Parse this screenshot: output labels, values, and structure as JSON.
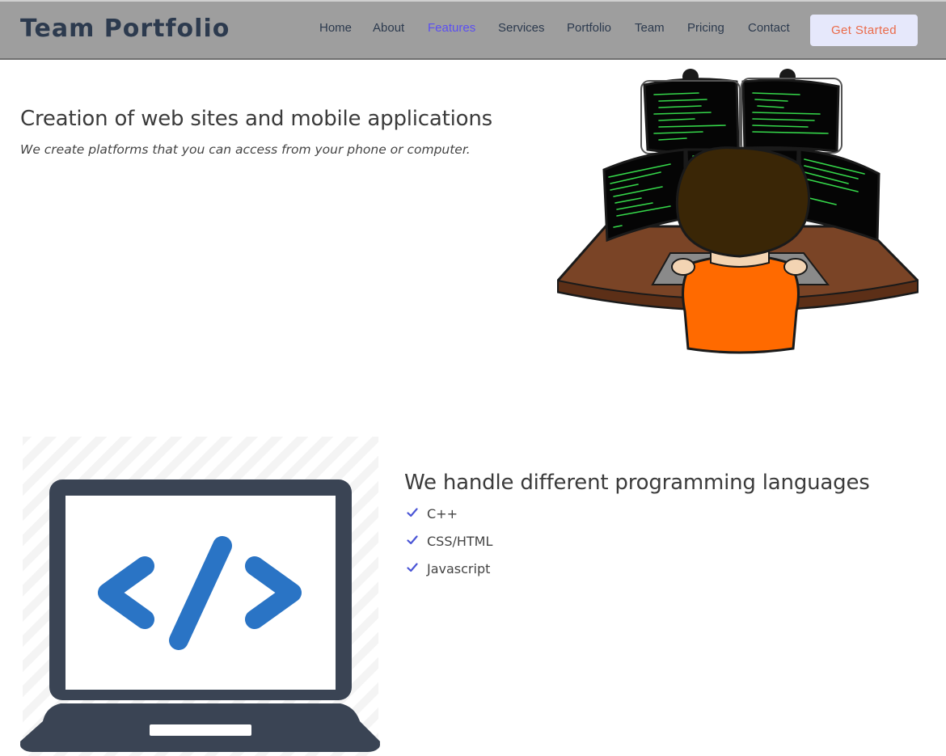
{
  "header": {
    "logo": "Team Portfolio",
    "nav": [
      {
        "label": "Home",
        "active": false
      },
      {
        "label": "About",
        "active": false
      },
      {
        "label": "Features",
        "active": true
      },
      {
        "label": "Services",
        "active": false
      },
      {
        "label": "Portfolio",
        "active": false
      },
      {
        "label": "Team",
        "active": false
      },
      {
        "label": "Pricing",
        "active": false
      },
      {
        "label": "Contact",
        "active": false
      }
    ],
    "cta_label": "Get Started"
  },
  "section1": {
    "title": "Creation of web sites and mobile applications",
    "subtitle": "We create platforms that you can access from your phone or computer.",
    "illustration": "programmer-at-multiple-monitors"
  },
  "section2": {
    "title": "We handle different programming languages",
    "illustration": "laptop-code-icon",
    "items": [
      {
        "label": "C++",
        "icon": "check-icon"
      },
      {
        "label": "CSS/HTML",
        "icon": "check-icon"
      },
      {
        "label": "Javascript",
        "icon": "check-icon"
      }
    ]
  },
  "colors": {
    "header_bg": "#9e9e9e",
    "nav_text": "#2c3a4e",
    "nav_active": "#5b4ff2",
    "cta_bg": "#e6e8fb",
    "cta_text": "#ea6b4a",
    "check": "#4a55d6"
  }
}
